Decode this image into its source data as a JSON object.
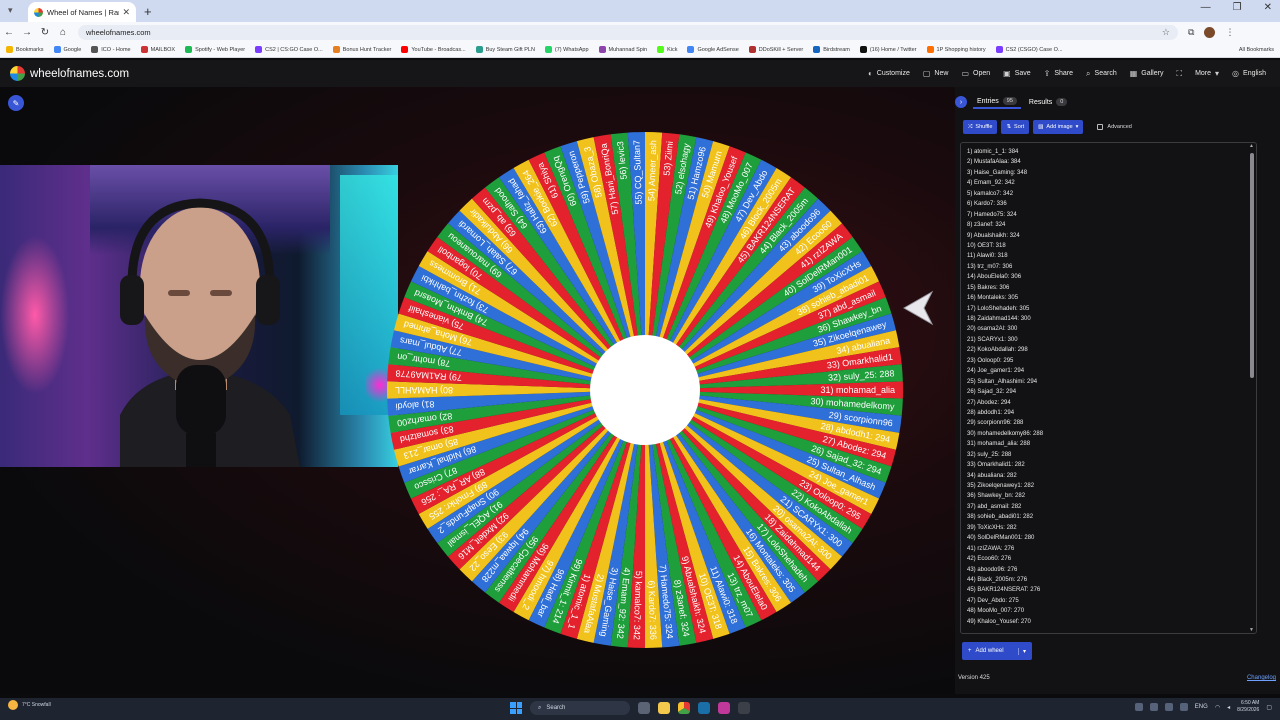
{
  "browser": {
    "tab_title": "Wheel of Names | Random",
    "url": "wheelofnames.com",
    "bookmarks": [
      "Bookmarks",
      "Google",
      "ICO - Home",
      "MAILBOX",
      "Spotify - Web Player",
      "CS2 | CS:GO Case O...",
      "Bonus Hunt Tracker",
      "YouTube - Broadcas...",
      "Buy Steam Gift PLN",
      "(7) WhatsApp",
      "Muhannad Spin",
      "Kick",
      "Google AdSense",
      "DDoSKill + Server",
      "Birdstream",
      "(16) Home / Twitter",
      "1P Shopping history",
      "CS2 (CSGO) Case O..."
    ],
    "all_bookmarks": "All Bookmarks"
  },
  "app": {
    "brand": "wheelofnames.com",
    "actions": [
      "Customize",
      "New",
      "Open",
      "Save",
      "Share",
      "Search",
      "Gallery",
      "More",
      "English"
    ]
  },
  "panel": {
    "tab_entries": "Entries",
    "entries_count": "95",
    "tab_results": "Results",
    "results_count": "0",
    "shuffle": "Shuffle",
    "sort": "Sort",
    "add_image": "Add image",
    "advanced": "Advanced",
    "add_wheel": "Add wheel",
    "version": "Version 425",
    "changelog": "Changelog",
    "entries": [
      "1) atomic_1_1: 384",
      "2) MustafaAlaa: 384",
      "3) Haise_Gaming: 348",
      "4) Emam_92: 342",
      "5) kamalco7: 342",
      "6) Kardo7: 336",
      "7) Hamedo75: 324",
      "8) z3anef: 324",
      "9) Abualshaikh: 324",
      "10) OE3T: 318",
      "11) Alawi0: 318",
      "13) trz_m07: 306",
      "14) AbouElela0: 306",
      "15) Bakres: 306",
      "16) Montaleks: 305",
      "17) LoloShehadeh: 305",
      "18) Zaidahmad144: 300",
      "20) osama2Al: 300",
      "21) SCARYx1: 300",
      "22) KokoAbdallah: 298",
      "23) Ooloop0: 295",
      "24) Joe_gamer1: 294",
      "25) Sultan_Alhashimi: 294",
      "26) Sajad_32: 294",
      "27) Abodez: 294",
      "28) abdodh1: 294",
      "29) scorpionn96: 288",
      "30) mohamedelkomy86: 288",
      "31) mohamad_alia: 288",
      "32) suly_25: 288",
      "33) Omarkhalid1: 282",
      "34) abualiana: 282",
      "35) Zikoelqenawey1: 282",
      "36) Shawkey_bn: 282",
      "37) abd_asmail: 282",
      "38) sohieb_abadi01: 282",
      "39) ToXicXHs: 282",
      "40) SolDelRMan001: 280",
      "41) rzIZAWA: 276",
      "42) Ecoo60: 276",
      "43) aboodo96: 276",
      "44) Black_2005m: 276",
      "45) BAKR124NSERAT: 276",
      "47) Dev_Abdo: 275",
      "48) MooMo_007: 270",
      "49) Khaloo_Yousef: 270"
    ]
  },
  "wheel": {
    "colors": [
      "#e3222e",
      "#1f9e3c",
      "#2f6fd8",
      "#f1c21b"
    ],
    "labels": [
      "31) mohamad_alia",
      "30) mohamedelkomy",
      "29) scorpionn96",
      "28) abdodh1: 294",
      "27) Abodez: 294",
      "26) Sajad_32: 294",
      "25) Sultan_Alhash",
      "24) Joe_gamer1",
      "23) Ooloop0: 295",
      "22) KokoAbdallah",
      "21) SCARYx1: 300",
      "20) osama2Al: 300",
      "18) Zaidahmad144",
      "17) LoloShehadeh",
      "16) Montaleks: 305",
      "15) Bakres: 306",
      "14) AbouElela0",
      "13) trz_m07",
      "11) Alawi0: 318",
      "10) OE3T: 318",
      "9) Abualshaikh: 324",
      "8) z3anef: 324",
      "7) Hamedo75: 324",
      "6) Kardo7: 336",
      "5) kamalco7: 342",
      "4) Emam_92: 342",
      "3) Haise_Gaming",
      "2) MustafaAlaa",
      "1) atomic_1_1",
      "99) Kirmit_1: 214",
      "98) Hadi_bar",
      "97) hmoodi_2",
      "96) Mohammedii",
      "95) Cpecaltienss",
      "94) Iqwaa_m228",
      "93) Eeso_22",
      "92) Mxdeit_M16",
      "91) AQEL_ismail",
      "90) SnapFunds_2",
      "89) Fmohkr: 255",
      "88) AR_RA_: 256",
      "87) Crissco",
      "86) Nidhal_Karrar",
      "85) omar_213",
      "83) somatzhd",
      "82) omarhz00",
      "81) aloydi",
      "80) HAMAHLL",
      "79) RA1MA9778",
      "78) mohtr_on",
      "77) Abdul_mars",
      "76) Moha_ahmed",
      "75) vianeshalif",
      "74) Bmkhn_Moasrd",
      "73) fozhn_bahhkbi",
      "71) Brommess",
      "70) loganboll",
      "69) marouaneou",
      "67) Salah_Lomardi",
      "66) Abdulkadir",
      "65) ab_pzm",
      "64) Salhood",
      "63) Hafiz_fahad",
      "62) Bookie_264",
      "61) Shiya",
      "60) OrengQq",
      "59) Pepperon",
      "58) Obaza_3",
      "57) Hani_BonriQa",
      "56) levic3",
      "55) CQ_Sultan7",
      "54) Ameer_ash",
      "53) Ziimi",
      "52) elsohagy",
      "51) Hamzo96",
      "50) Mamurn",
      "49) Khaloo_Yousef",
      "48) MooMo_007",
      "47) Dev_Abdo",
      "46) Block_2005m",
      "45) BAKR124NSERAT",
      "44) Black_2005m",
      "43) aboodo96",
      "42) Ecoo60",
      "41) rzIZAWA",
      "40) SolDelRMan001",
      "39) ToXicXHs",
      "38) sohieb_abadi01",
      "37) abd_asmail",
      "36) Shawkey_bn",
      "35) Zikoelqenawey",
      "34) abualiana",
      "33) Omarkhalid1",
      "32) suly_25: 288"
    ]
  },
  "taskbar": {
    "weather": "7°C Snowfall",
    "search": "Search",
    "lang": "ENG",
    "time": "6:50 AM",
    "date": "8/29/2026"
  }
}
